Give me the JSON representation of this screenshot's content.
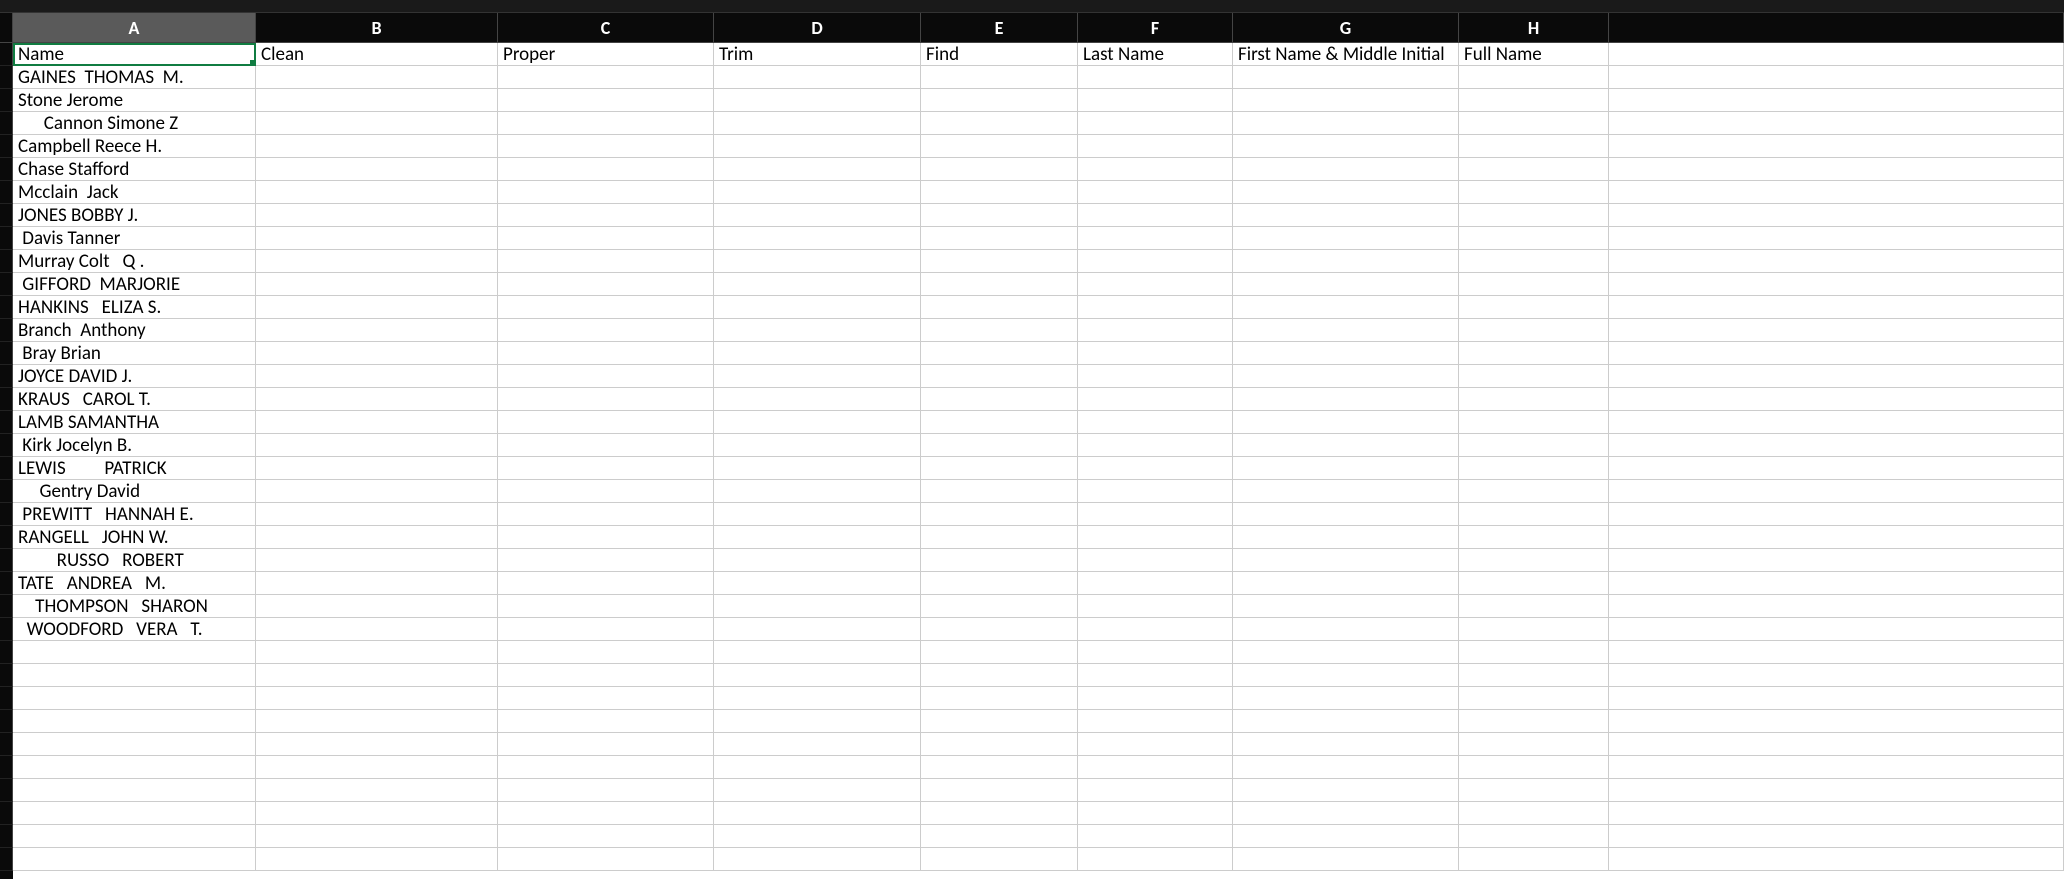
{
  "columns": [
    {
      "letter": "A",
      "class": "col-A",
      "selected": true
    },
    {
      "letter": "B",
      "class": "col-B",
      "selected": false
    },
    {
      "letter": "C",
      "class": "col-C",
      "selected": false
    },
    {
      "letter": "D",
      "class": "col-D",
      "selected": false
    },
    {
      "letter": "E",
      "class": "col-E",
      "selected": false
    },
    {
      "letter": "F",
      "class": "col-F",
      "selected": false
    },
    {
      "letter": "G",
      "class": "col-G",
      "selected": false
    },
    {
      "letter": "H",
      "class": "col-H",
      "selected": false
    }
  ],
  "headerRow": {
    "A": "Name",
    "B": "Clean",
    "C": "Proper",
    "D": "Trim",
    "E": "Find",
    "F": "Last Name",
    "G": "First Name & Middle Initial",
    "H": "Full Name"
  },
  "dataRows": [
    {
      "A": "GAINES  THOMAS  M."
    },
    {
      "A": "Stone Jerome"
    },
    {
      "A": "      Cannon Simone Z"
    },
    {
      "A": "Campbell Reece H."
    },
    {
      "A": "Chase Stafford"
    },
    {
      "A": "Mcclain  Jack"
    },
    {
      "A": "JONES BOBBY J."
    },
    {
      "A": " Davis Tanner"
    },
    {
      "A": "Murray Colt   Q ."
    },
    {
      "A": " GIFFORD  MARJORIE"
    },
    {
      "A": "HANKINS   ELIZA S."
    },
    {
      "A": "Branch  Anthony"
    },
    {
      "A": " Bray Brian"
    },
    {
      "A": "JOYCE DAVID J."
    },
    {
      "A": "KRAUS   CAROL T."
    },
    {
      "A": "LAMB SAMANTHA"
    },
    {
      "A": " Kirk Jocelyn B."
    },
    {
      "A": "LEWIS         PATRICK"
    },
    {
      "A": "     Gentry David"
    },
    {
      "A": " PREWITT   HANNAH E."
    },
    {
      "A": "RANGELL   JOHN W."
    },
    {
      "A": "         RUSSO   ROBERT"
    },
    {
      "A": "TATE   ANDREA   M."
    },
    {
      "A": "    THOMPSON   SHARON"
    },
    {
      "A": "  WOODFORD   VERA   T."
    }
  ],
  "activeCell": {
    "row": 0,
    "col": "A"
  },
  "emptyRowsAfter": 10
}
